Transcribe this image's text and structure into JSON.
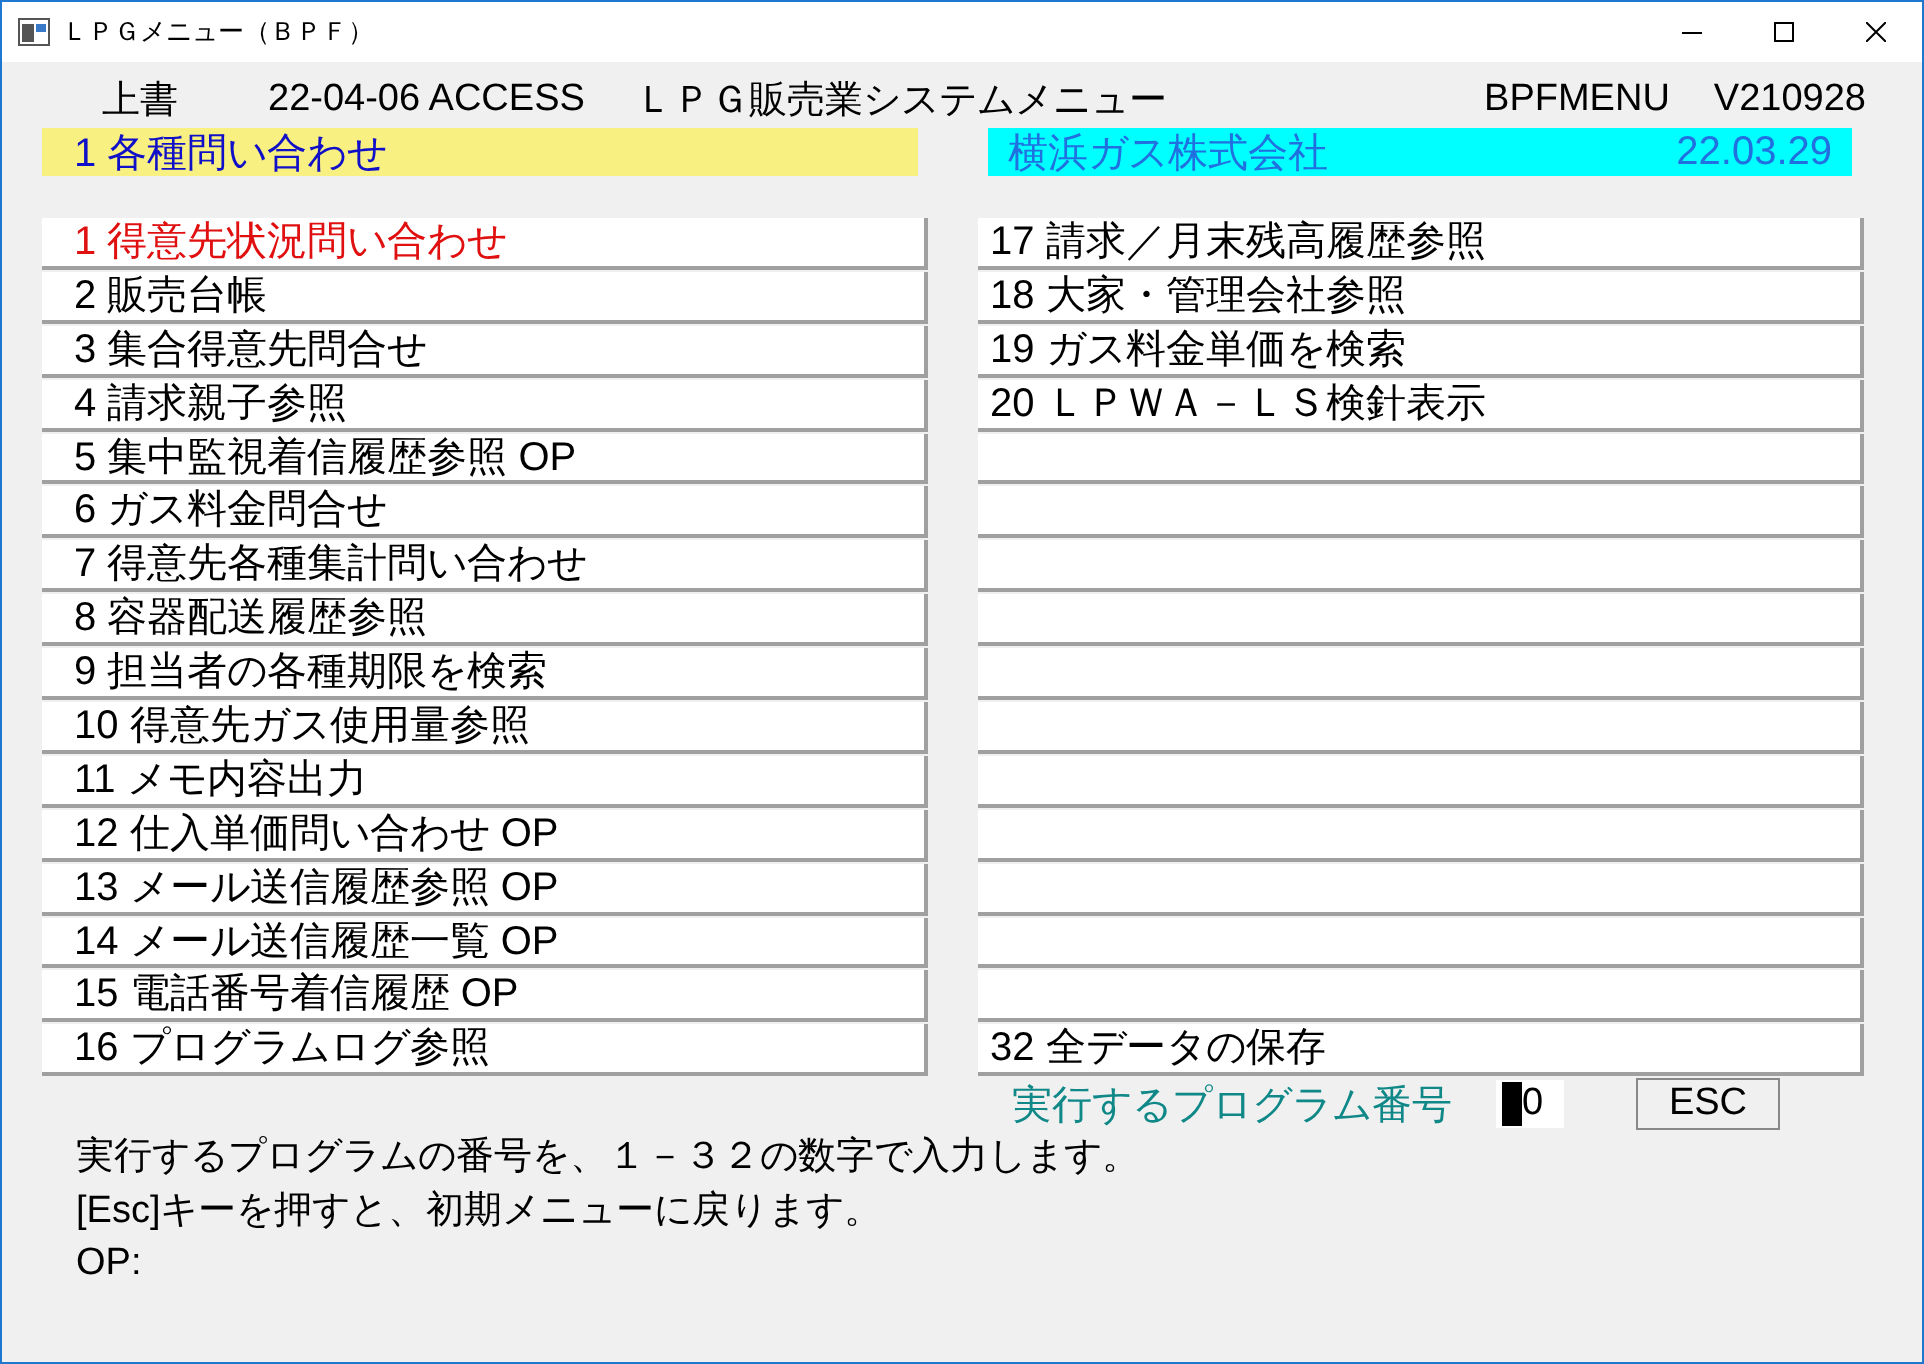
{
  "window": {
    "title": "ＬＰＧメニュー（ＢＰＦ）"
  },
  "header": {
    "mode": "上書",
    "date": "22-04-06 ACCESS",
    "system_title": "ＬＰＧ販売業システムメニュー",
    "program_id": "BPFMENU",
    "version": "V210928"
  },
  "menu_group": {
    "label": "1 各種問い合わせ"
  },
  "company": {
    "name": "横浜ガス株式会社",
    "date": "22.03.29"
  },
  "menu_left": [
    {
      "kind": "entry",
      "label": "1 得意先状況問い合わせ",
      "selected": true
    },
    {
      "kind": "entry",
      "label": "2 販売台帳",
      "selected": false
    },
    {
      "kind": "entry",
      "label": "3 集合得意先問合せ",
      "selected": false
    },
    {
      "kind": "entry",
      "label": "4 請求親子参照",
      "selected": false
    },
    {
      "kind": "entry",
      "label": "5 集中監視着信履歴参照 OP",
      "selected": false
    },
    {
      "kind": "entry",
      "label": "6 ガス料金問合せ",
      "selected": false
    },
    {
      "kind": "entry",
      "label": "7 得意先各種集計問い合わせ",
      "selected": false
    },
    {
      "kind": "entry",
      "label": "8 容器配送履歴参照",
      "selected": false
    },
    {
      "kind": "entry",
      "label": "9 担当者の各種期限を検索",
      "selected": false
    },
    {
      "kind": "entry",
      "label": "10 得意先ガス使用量参照",
      "selected": false
    },
    {
      "kind": "entry",
      "label": "11 メモ内容出力",
      "selected": false
    },
    {
      "kind": "entry",
      "label": "12 仕入単価問い合わせ OP",
      "selected": false
    },
    {
      "kind": "entry",
      "label": "13 メール送信履歴参照 OP",
      "selected": false
    },
    {
      "kind": "entry",
      "label": "14 メール送信履歴一覧 OP",
      "selected": false
    },
    {
      "kind": "entry",
      "label": "15 電話番号着信履歴 OP",
      "selected": false
    },
    {
      "kind": "entry",
      "label": "16 プログラムログ参照",
      "selected": false
    }
  ],
  "menu_right": [
    {
      "kind": "entry",
      "label": "17 請求／月末残高履歴参照",
      "selected": false
    },
    {
      "kind": "entry",
      "label": "18 大家・管理会社参照",
      "selected": false
    },
    {
      "kind": "entry",
      "label": "19 ガス料金単価を検索",
      "selected": false
    },
    {
      "kind": "entry",
      "label": "20 ＬＰＷＡ－ＬＳ検針表示",
      "selected": false
    },
    {
      "kind": "blank"
    },
    {
      "kind": "blank"
    },
    {
      "kind": "blank"
    },
    {
      "kind": "blank"
    },
    {
      "kind": "blank"
    },
    {
      "kind": "blank"
    },
    {
      "kind": "blank"
    },
    {
      "kind": "blank"
    },
    {
      "kind": "blank"
    },
    {
      "kind": "blank"
    },
    {
      "kind": "blank"
    },
    {
      "kind": "entry",
      "label": "32 全データの保存",
      "selected": false
    }
  ],
  "prompt": {
    "label": "実行するプログラム番号",
    "value": "0",
    "button": "ESC"
  },
  "messages": [
    "実行するプログラムの番号を、１－３２の数字で入力します。",
    "[Esc]キーを押すと、初期メニューに戻ります。",
    "OP:"
  ]
}
